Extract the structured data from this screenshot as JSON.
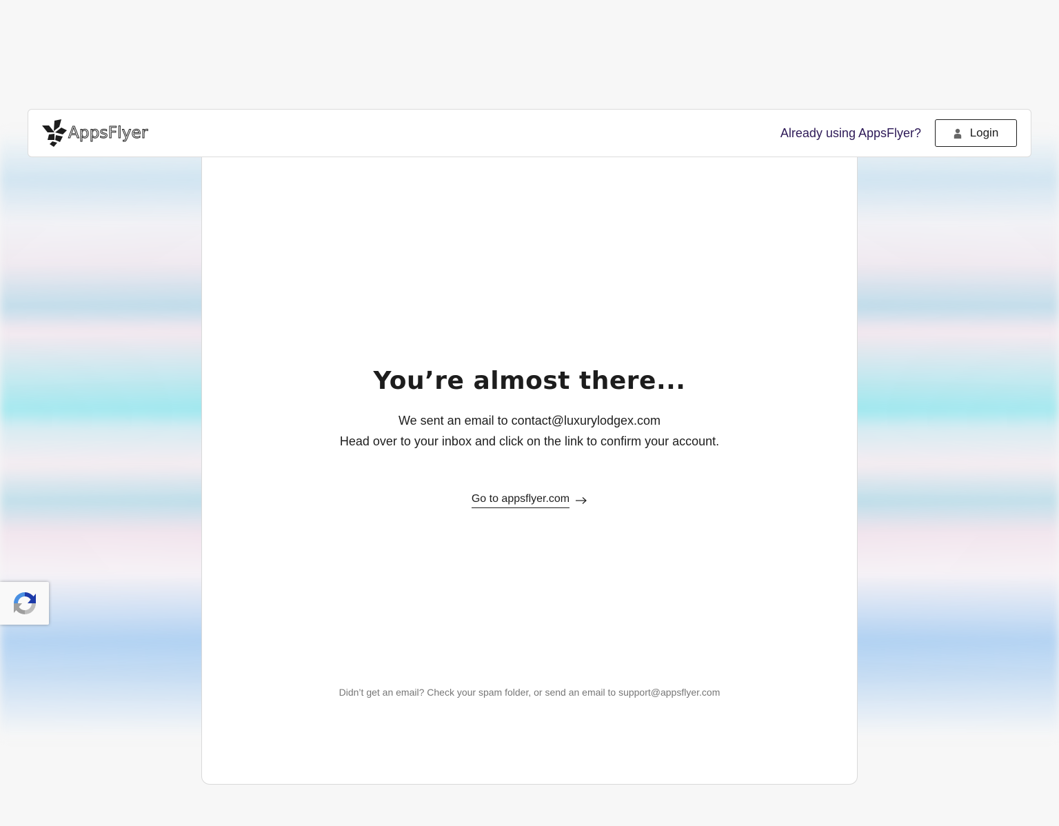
{
  "header": {
    "logo_text": "AppsFlyer",
    "already_text": "Already using AppsFlyer?",
    "login_label": "Login"
  },
  "main": {
    "title": "You’re almost there...",
    "line1": "We sent an email to contact@luxurylodgex.com",
    "line2": "Head over to your inbox and click on the link to confirm your account.",
    "link_label": "Go to appsflyer.com",
    "footnote": "Didn’t get an email? Check your spam folder, or send an email to support@appsflyer.com"
  },
  "icons": {
    "logo": "appsflyer-logo-icon",
    "login": "user-icon",
    "arrow": "arrow-right-icon",
    "recaptcha": "recaptcha-icon"
  },
  "colors": {
    "accent_text": "#2d1957",
    "text": "#1d1d1d",
    "muted": "#777777",
    "background": "#f7f7f7"
  }
}
